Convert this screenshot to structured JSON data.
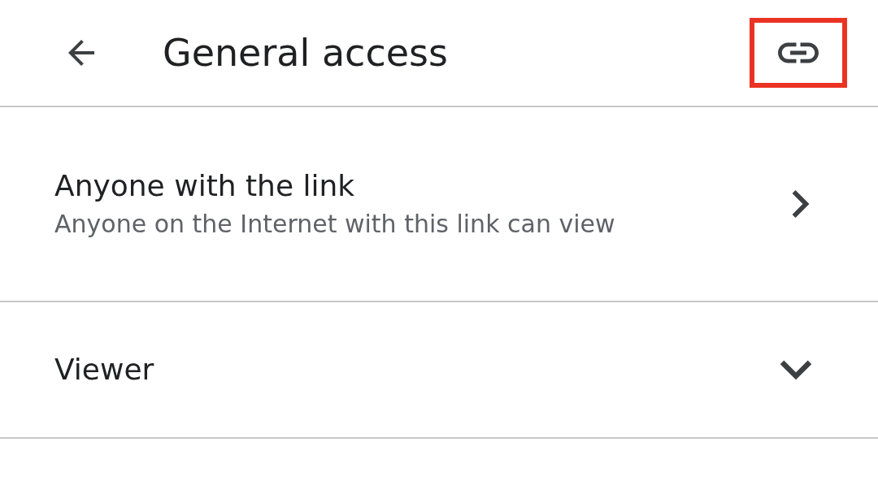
{
  "header": {
    "title": "General access",
    "link_button": {
      "highlighted": true
    }
  },
  "access_option": {
    "title": "Anyone with the link",
    "description": "Anyone on the Internet with this link can view"
  },
  "role_option": {
    "label": "Viewer",
    "expanded": false
  }
}
